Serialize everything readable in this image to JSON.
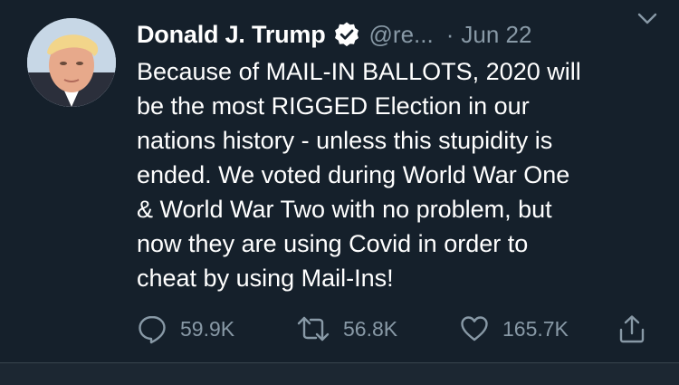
{
  "tweet": {
    "author": {
      "display_name": "Donald J. Trump",
      "handle": "@re...",
      "verified": true,
      "avatar_icon": "profile-photo-icon"
    },
    "separator": "·",
    "date": "Jun 22",
    "text": "Because of MAIL-IN BALLOTS, 2020 will\nbe the most RIGGED Election in our\nnations history - unless this stupidity is\nended. We voted during World War One\n& World War Two with no problem, but\nnow they are using Covid in order to\ncheat by using Mail-Ins!",
    "actions": {
      "reply": {
        "icon": "reply-icon",
        "count": "59.9K"
      },
      "retweet": {
        "icon": "retweet-icon",
        "count": "56.8K"
      },
      "like": {
        "icon": "heart-icon",
        "count": "165.7K"
      },
      "share": {
        "icon": "share-icon"
      }
    },
    "menu_icon": "chevron-down-icon"
  },
  "colors": {
    "background": "#15202b",
    "primary_text": "#ffffff",
    "secondary_text": "#8899a6",
    "divider": "#38444d"
  }
}
